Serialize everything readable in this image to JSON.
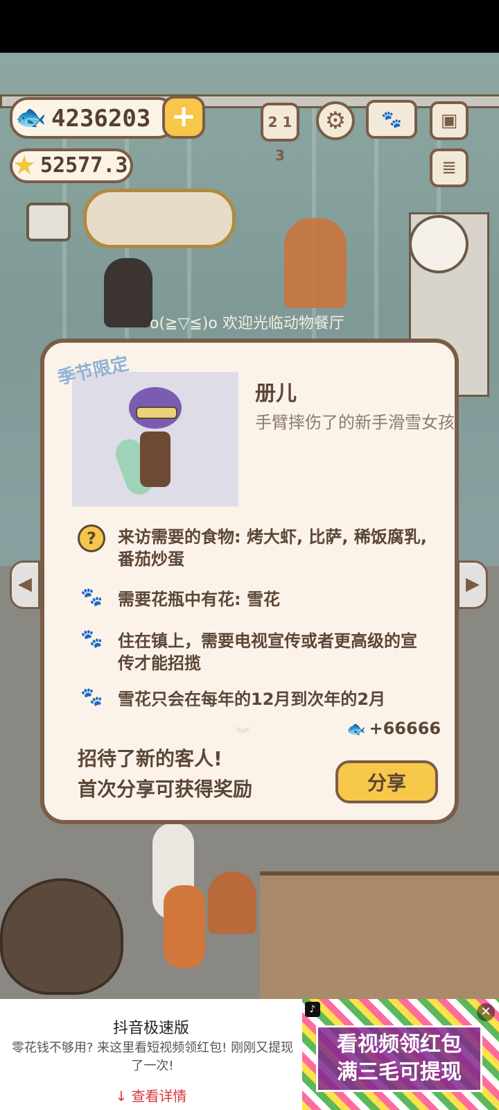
{
  "hud": {
    "fish_count": "4236203",
    "star_count": "52577.3",
    "icons": [
      "fish-icon",
      "plus-icon",
      "star-icon",
      "ranking-icon",
      "settings-gear-icon",
      "paw-book-icon",
      "camera-icon",
      "newspaper-icon",
      "shop-icon"
    ]
  },
  "scene": {
    "welcome_text": "o(≧▽≦)o 欢迎光临动物餐厅"
  },
  "popup": {
    "badge": "季节限定",
    "name": "册儿",
    "description": "手臂摔伤了的新手滑雪女孩",
    "requirements": [
      {
        "icon": "question-icon",
        "text": "来访需要的食物: 烤大虾, 比萨, 稀饭腐乳, 番茄炒蛋"
      },
      {
        "icon": "paw-icon",
        "text": "需要花瓶中有花: 雪花"
      },
      {
        "icon": "paw-icon",
        "text": "住在镇上，需要电视宣传或者更高级的宣传才能招揽"
      },
      {
        "icon": "paw-icon",
        "text": "雪花只会在每年的12月到次年的2月"
      }
    ],
    "reward": "+66666",
    "message_line1": "招待了新的客人!",
    "message_line2": "首次分享可获得奖励",
    "share_label": "分享"
  },
  "ad": {
    "title": "抖音极速版",
    "body": "零花钱不够用? 来这里看短视频领红包! 刚刚又提现了一次!",
    "link": "查看详情",
    "banner_line1": "看视频领红包",
    "banner_line2": "满三毛可提现",
    "close": "✕",
    "colors": {
      "banner": "#80288c",
      "link": "#d9363e"
    }
  }
}
